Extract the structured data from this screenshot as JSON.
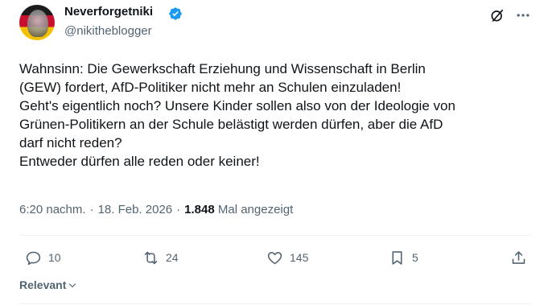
{
  "author": {
    "display_name": "Neverforgetniki",
    "handle": "@nikitheblogger",
    "verified_icon": "verified-badge-icon",
    "accent_color": "#1d9bf0"
  },
  "tweet": {
    "text": "Wahnsinn: Die Gewerkschaft Erziehung und Wissenschaft in Berlin\n(GEW) fordert, AfD-Politiker nicht mehr an Schulen einzuladen!\nGeht's eigentlich noch? Unsere Kinder sollen also von der Ideologie von\nGrünen-Politikern an der Schule belästigt werden dürfen, aber die AfD\ndarf nicht reden?\nEntweder dürfen alle reden oder keiner!"
  },
  "meta": {
    "time": "6:20 nachm.",
    "separator": "·",
    "date": "18. Feb. 2026",
    "views_count": "1.848",
    "views_label": "Mal angezeigt"
  },
  "actions": {
    "replies": "10",
    "reposts": "24",
    "likes": "145",
    "bookmarks": "5"
  },
  "sort": {
    "label": "Relevant"
  },
  "icons": {
    "grok": "grok-icon",
    "more": "more-dots-icon",
    "reply": "reply-icon",
    "repost": "repost-icon",
    "like": "heart-icon",
    "bookmark": "bookmark-icon",
    "share": "share-icon",
    "chevron": "chevron-down-icon"
  }
}
